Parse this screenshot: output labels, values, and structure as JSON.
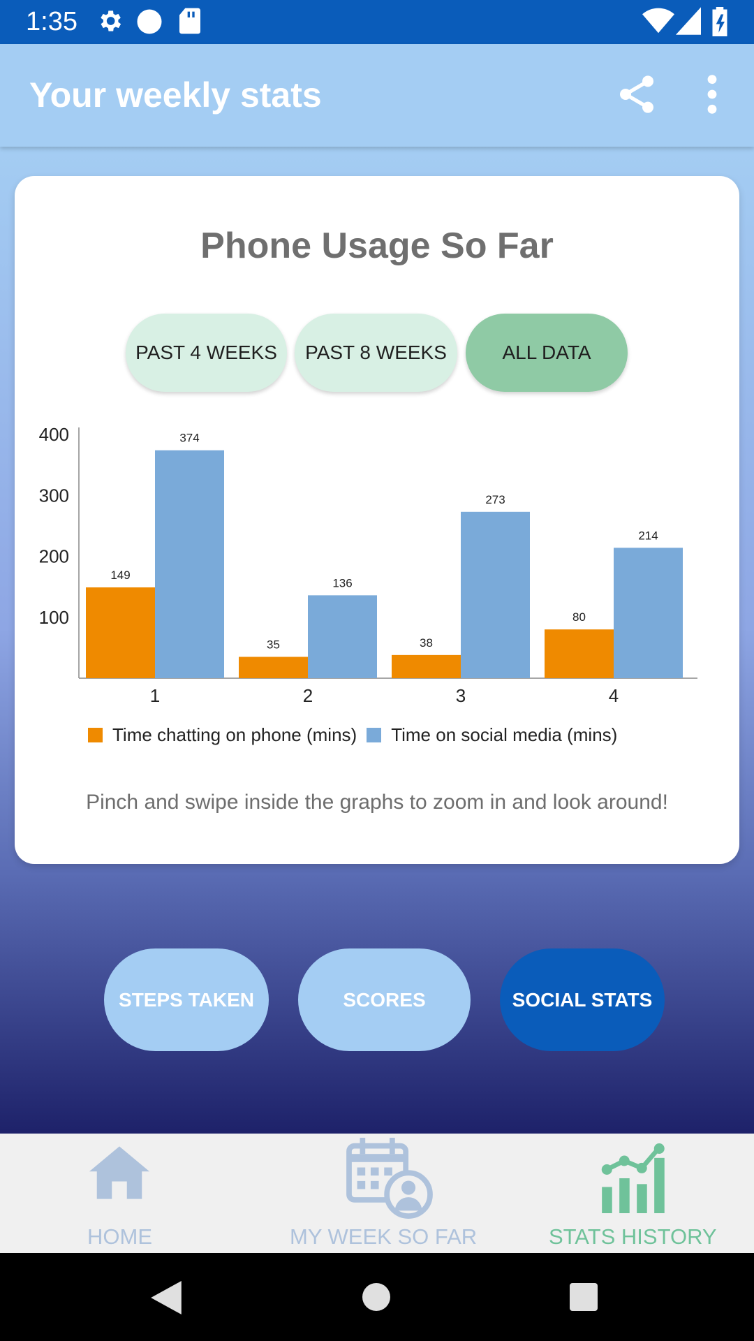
{
  "status_bar": {
    "time": "1:35",
    "icons": [
      "gear-icon",
      "circle-icon",
      "sd-card-icon",
      "wifi-icon",
      "signal-icon",
      "battery-icon"
    ]
  },
  "app_bar": {
    "title": "Your weekly stats",
    "actions": [
      "share-icon",
      "overflow-menu-icon"
    ]
  },
  "card": {
    "title": "Phone Usage So Far",
    "range_buttons": [
      "PAST 4 WEEKS",
      "PAST 8 WEEKS",
      "ALL DATA"
    ],
    "selected_range": "ALL DATA",
    "hint": "Pinch and swipe inside the graphs to zoom in and look around!"
  },
  "chart_data": {
    "type": "bar",
    "categories": [
      "1",
      "2",
      "3",
      "4"
    ],
    "series": [
      {
        "name": "Time chatting on phone (mins)",
        "values": [
          149,
          35,
          38,
          80
        ],
        "color": "#ef8a00"
      },
      {
        "name": "Time on social media (mins)",
        "values": [
          374,
          136,
          273,
          214
        ],
        "color": "#7aaad9"
      }
    ],
    "y_ticks": [
      100,
      200,
      300,
      400
    ],
    "ylim": [
      0,
      400
    ],
    "grid": false,
    "legend": "bottom-left",
    "data_labels": true
  },
  "category_buttons": [
    "STEPS TAKEN",
    "SCORES",
    "SOCIAL STATS"
  ],
  "selected_category": "SOCIAL STATS",
  "bottom_nav": {
    "items": [
      {
        "label": "HOME",
        "icon": "home-icon"
      },
      {
        "label": "MY WEEK SO FAR",
        "icon": "calendar-user-icon"
      },
      {
        "label": "STATS HISTORY",
        "icon": "stats-chart-icon"
      }
    ],
    "active": "STATS HISTORY"
  },
  "colors": {
    "status_bar": "#0a5cba",
    "app_bar": "#a4cdf3",
    "accent_green": "#8fcaa5",
    "active_nav": "#6fc29a",
    "inactive_nav": "#aec2dc"
  },
  "system_nav": [
    "back-icon",
    "home-circle-icon",
    "recents-icon"
  ]
}
